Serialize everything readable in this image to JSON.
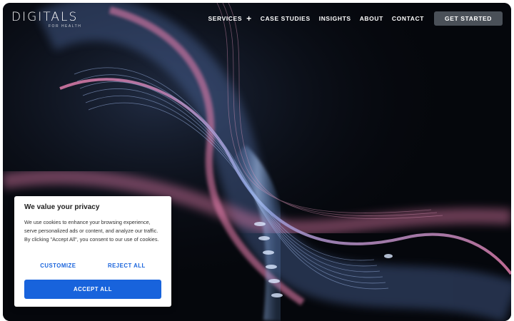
{
  "brand": {
    "name": "DIGITALS",
    "tagline": "FOR HEALTH"
  },
  "nav": {
    "items": [
      {
        "label": "SERVICES",
        "icon": "plus-icon"
      },
      {
        "label": "CASE STUDIES"
      },
      {
        "label": "INSIGHTS"
      },
      {
        "label": "ABOUT"
      },
      {
        "label": "CONTACT"
      }
    ],
    "plus_glyph": "+",
    "cta_label": "GET STARTED"
  },
  "cookie": {
    "title": "We value your privacy",
    "body": "We use cookies to enhance your browsing experience, serve personalized ads or content, and analyze our traffic. By clicking \"Accept All\", you consent to our use of cookies.",
    "customize_label": "CUSTOMIZE",
    "reject_label": "REJECT ALL",
    "accept_label": "ACCEPT ALL"
  },
  "colors": {
    "hero_background": "#05070c",
    "cta_background": "#4a5058",
    "accent_blue": "#1863dc",
    "wave_pink": "#e07aa8",
    "wave_blue": "#6f9bdc"
  }
}
